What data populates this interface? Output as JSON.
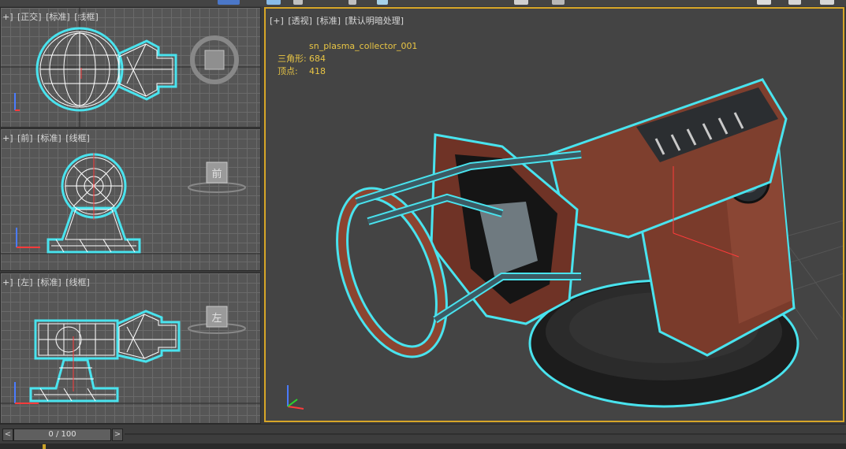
{
  "viewports": {
    "top": {
      "labels": [
        "+]",
        "[正交]",
        "[标准]",
        "[线框]"
      ],
      "cube_text": ""
    },
    "front": {
      "labels": [
        "+]",
        "[前]",
        "[标准]",
        "[线框]"
      ],
      "cube_text": "前"
    },
    "left": {
      "labels": [
        "+]",
        "[左]",
        "[标准]",
        "[线框]"
      ],
      "cube_text": "左"
    },
    "perspective": {
      "labels": [
        "[+]",
        "[透视]",
        "[标准]",
        "[默认明暗处理]"
      ],
      "object_name": "sn_plasma_collector_001",
      "stats": [
        {
          "key": "三角形:",
          "value": "684"
        },
        {
          "key": "顶点:",
          "value": "418"
        }
      ]
    }
  },
  "timeline": {
    "prev_label": "<",
    "next_label": ">",
    "frame_display": "0 / 100"
  },
  "colors": {
    "selection_outline": "#49e3ee",
    "active_border": "#d7a628",
    "rust": "#8a4634"
  }
}
